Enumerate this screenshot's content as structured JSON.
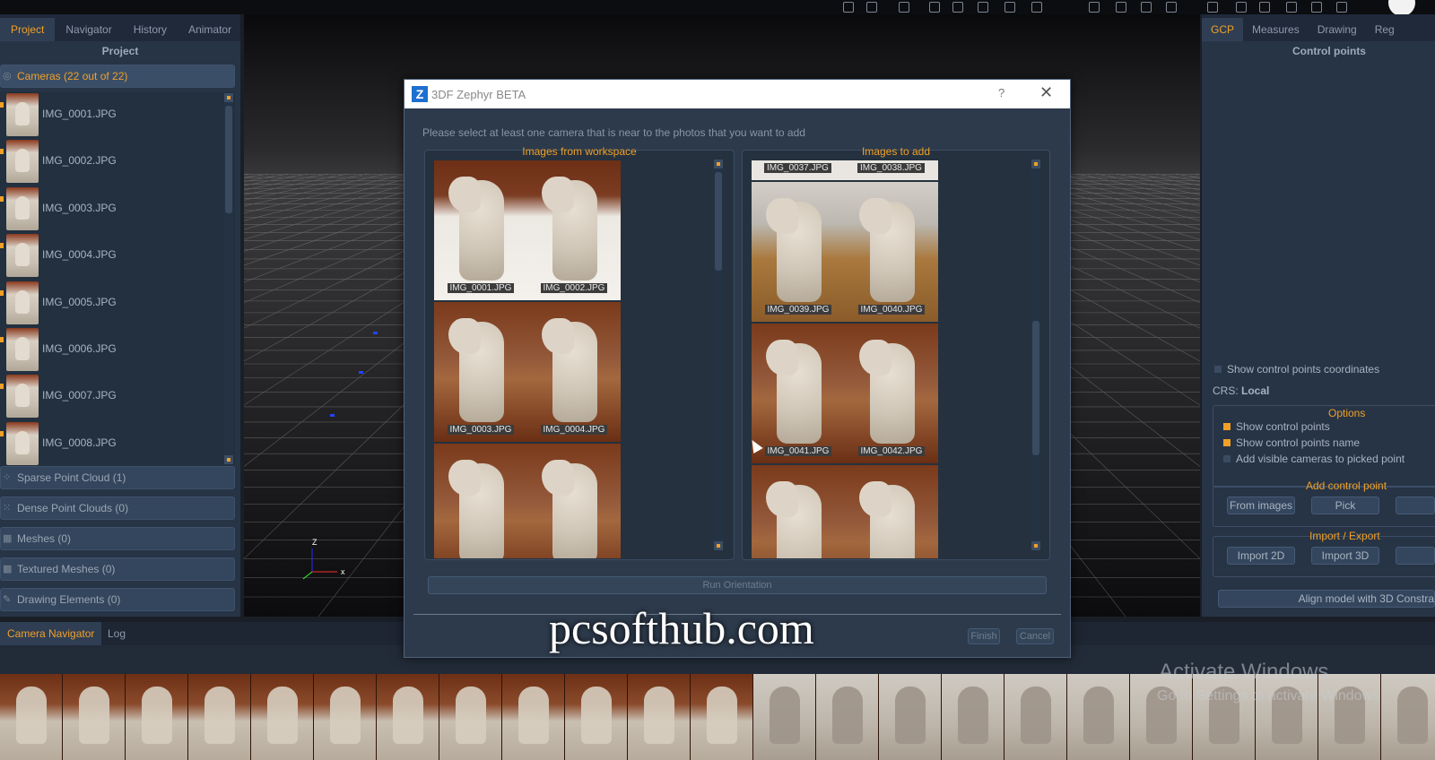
{
  "left_panel": {
    "tabs": [
      "Project",
      "Navigator",
      "History",
      "Animator"
    ],
    "title": "Project",
    "cameras_section": "Cameras (22 out of 22)",
    "cameras": [
      "IMG_0001.JPG",
      "IMG_0002.JPG",
      "IMG_0003.JPG",
      "IMG_0004.JPG",
      "IMG_0005.JPG",
      "IMG_0006.JPG",
      "IMG_0007.JPG",
      "IMG_0008.JPG"
    ],
    "sections": [
      "Sparse Point Cloud (1)",
      "Dense Point Clouds (0)",
      "Meshes (0)",
      "Textured Meshes (0)",
      "Drawing Elements (0)"
    ]
  },
  "viewport": {
    "axis_z": "Z",
    "axis_x": "x"
  },
  "right_panel": {
    "tabs": [
      "GCP",
      "Measures",
      "Drawing",
      "Reg"
    ],
    "title": "Control points",
    "show_coords": "Show control points coordinates",
    "crs_label": "CRS:",
    "crs_value": "Local",
    "options_title": "Options",
    "options": [
      {
        "label": "Show control points",
        "checked": true
      },
      {
        "label": "Show control points name",
        "checked": true
      },
      {
        "label": "Add visible cameras to picked point",
        "checked": false
      }
    ],
    "add_cp_title": "Add control point",
    "add_cp_buttons": [
      "From images",
      "Pick"
    ],
    "import_export_title": "Import / Export",
    "import_buttons": [
      "Import 2D",
      "Import 3D"
    ],
    "align_button": "Align model with 3D Constra"
  },
  "bottom": {
    "tabs": [
      "Camera Navigator",
      "Log"
    ]
  },
  "dialog": {
    "title": "3DF Zephyr BETA",
    "help": "?",
    "close": "✕",
    "instruction": "Please select at least one camera that is near to the photos that you want to add",
    "left_panel_title": "Images from workspace",
    "right_panel_title": "Images to add",
    "workspace_images": [
      "IMG_0001.JPG",
      "IMG_0002.JPG",
      "IMG_0003.JPG",
      "IMG_0004.JPG"
    ],
    "add_images_header": [
      "IMG_0037.JPG",
      "IMG_0038.JPG"
    ],
    "add_images": [
      "IMG_0039.JPG",
      "IMG_0040.JPG",
      "IMG_0041.JPG",
      "IMG_0042.JPG"
    ],
    "run_orientation": "Run Orientation",
    "finish": "Finish",
    "cancel": "Cancel"
  },
  "overlays": {
    "watermark": "pcsofthub.com",
    "activate_title": "Activate Windows",
    "activate_sub": "Go to Settings to activate Windows"
  },
  "colors": {
    "accent": "#f0a028",
    "panel": "#273446",
    "dialog_bg": "#2d3a4b"
  }
}
